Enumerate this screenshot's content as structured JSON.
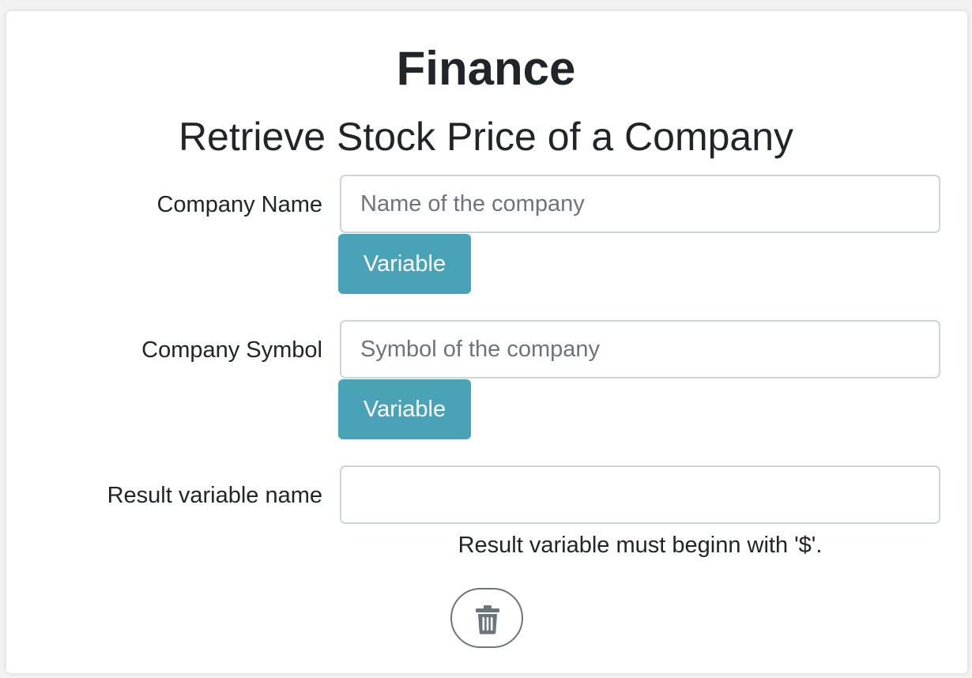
{
  "header": {
    "title": "Finance",
    "subtitle": "Retrieve Stock Price of a Company"
  },
  "form": {
    "company_name": {
      "label": "Company Name",
      "value": "",
      "placeholder": "Name of the company",
      "variable_button": "Variable"
    },
    "company_symbol": {
      "label": "Company Symbol",
      "value": "",
      "placeholder": "Symbol of the company",
      "variable_button": "Variable"
    },
    "result_variable": {
      "label": "Result variable name",
      "value": "",
      "placeholder": "",
      "hint": "Result variable must beginn with '$'."
    }
  },
  "actions": {
    "delete_icon": "trash-icon"
  },
  "colors": {
    "variable_button_bg": "#4aa2b7",
    "text": "#212529",
    "input_border": "#ced4da",
    "delete_icon": "#6c757d"
  }
}
